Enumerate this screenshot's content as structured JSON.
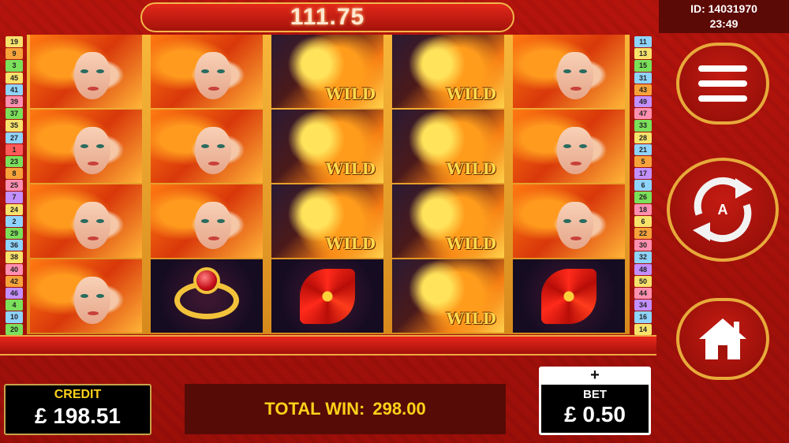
{
  "header": {
    "win_display": "111.75"
  },
  "session": {
    "id_text": "ID: 14031970",
    "time": "23:49"
  },
  "left_paylines": [
    "19",
    "9",
    "3",
    "45",
    "41",
    "39",
    "37",
    "35",
    "27",
    "1",
    "23",
    "8",
    "25",
    "7",
    "24",
    "2",
    "29",
    "36",
    "38",
    "40",
    "42",
    "46",
    "4",
    "10",
    "20"
  ],
  "right_paylines": [
    "11",
    "13",
    "15",
    "31",
    "43",
    "49",
    "47",
    "33",
    "28",
    "21",
    "5",
    "17",
    "6",
    "26",
    "18",
    "6",
    "22",
    "30",
    "32",
    "48",
    "50",
    "44",
    "34",
    "16",
    "14",
    "12"
  ],
  "left_payline_colors": [
    "#f7e26b",
    "#f7a23a",
    "#7be05a",
    "#f7e26b",
    "#8fd4ff",
    "#ff8fb0",
    "#7be05a",
    "#f7e26b",
    "#8fd4ff",
    "#ff5a5a",
    "#7be05a",
    "#f7a23a",
    "#ff8fb0",
    "#c48fff",
    "#f7e26b",
    "#8fd4ff",
    "#7be05a",
    "#8fd4ff",
    "#f7e26b",
    "#ff8fb0",
    "#f7a23a",
    "#c48fff",
    "#7be05a",
    "#8fd4ff",
    "#7be05a"
  ],
  "right_payline_colors": [
    "#8fd4ff",
    "#f7e26b",
    "#7be05a",
    "#8fd4ff",
    "#f7a23a",
    "#c48fff",
    "#ff8fb0",
    "#7be05a",
    "#f7e26b",
    "#8fd4ff",
    "#f7a23a",
    "#c48fff",
    "#8fd4ff",
    "#7be05a",
    "#ff8fb0",
    "#f7e26b",
    "#f7a23a",
    "#ff8fb0",
    "#8fd4ff",
    "#c48fff",
    "#f7e26b",
    "#ff8fb0",
    "#c48fff",
    "#8fd4ff",
    "#f7e26b",
    "#8fd4ff"
  ],
  "reels": [
    [
      "woman",
      "woman",
      "woman",
      "woman"
    ],
    [
      "woman",
      "woman",
      "woman",
      "ring"
    ],
    [
      "wild",
      "wild",
      "wild",
      "lily"
    ],
    [
      "wild",
      "wild",
      "wild",
      "wild"
    ],
    [
      "woman",
      "woman",
      "woman",
      "lily"
    ]
  ],
  "wild_label": "WILD",
  "credit": {
    "label": "CREDIT",
    "value": "£ 198.51"
  },
  "total_win": {
    "label": "TOTAL WIN:",
    "value": "298.00"
  },
  "bet": {
    "plus": "+",
    "label": "BET",
    "value": "£ 0.50"
  },
  "buttons": {
    "autoplay_label": "A"
  },
  "icons": {
    "menu": "hamburger-menu-icon",
    "spin": "autoplay-spin-icon",
    "home": "home-icon"
  },
  "colors": {
    "gold": "#ffd21a",
    "button_border": "#e8a93a"
  }
}
